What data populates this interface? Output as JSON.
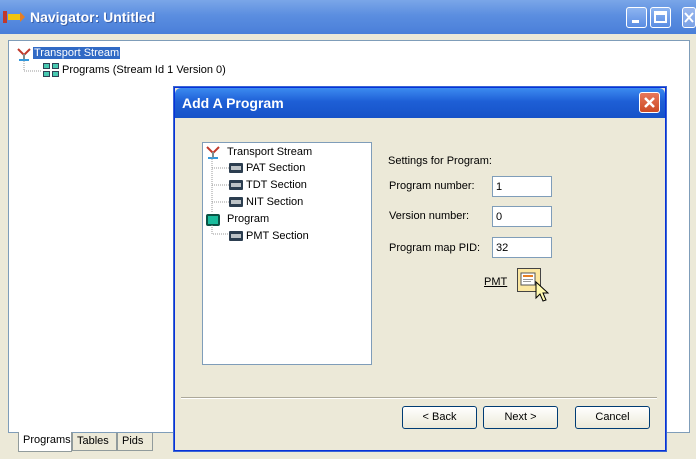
{
  "window": {
    "title": "Navigator: Untitled"
  },
  "main_tree": {
    "items": [
      {
        "label": "Transport Stream",
        "selected": true,
        "icon": "transport-stream-icon"
      },
      {
        "label": "Programs (Stream Id 1 Version 0)",
        "icon": "programs-icon"
      }
    ]
  },
  "bottom_tabs": [
    "Programs",
    "Tables",
    "Pids"
  ],
  "dialog": {
    "title": "Add A Program",
    "tree": [
      {
        "label": "Transport Stream",
        "icon": "transport-stream-icon"
      },
      {
        "label": "PAT Section",
        "icon": "section-icon"
      },
      {
        "label": "TDT Section",
        "icon": "section-icon"
      },
      {
        "label": "NIT Section",
        "icon": "section-icon"
      },
      {
        "label": "Program",
        "icon": "program-icon"
      },
      {
        "label": "PMT Section",
        "icon": "section-icon"
      }
    ],
    "settings_heading": "Settings for Program:",
    "fields": [
      {
        "label": "Program number:",
        "value": "1"
      },
      {
        "label": "Version number:",
        "value": "0"
      },
      {
        "label": "Program map PID:",
        "value": "32"
      }
    ],
    "pmt_label": "PMT",
    "buttons": {
      "back": "< Back",
      "next": "Next >",
      "cancel": "Cancel"
    }
  },
  "colors": {
    "title_bar": "#4a7fd9",
    "selection": "#316AC5",
    "dialog_title_bar": "#1e5fd6",
    "close_button": "#cc4a25"
  }
}
